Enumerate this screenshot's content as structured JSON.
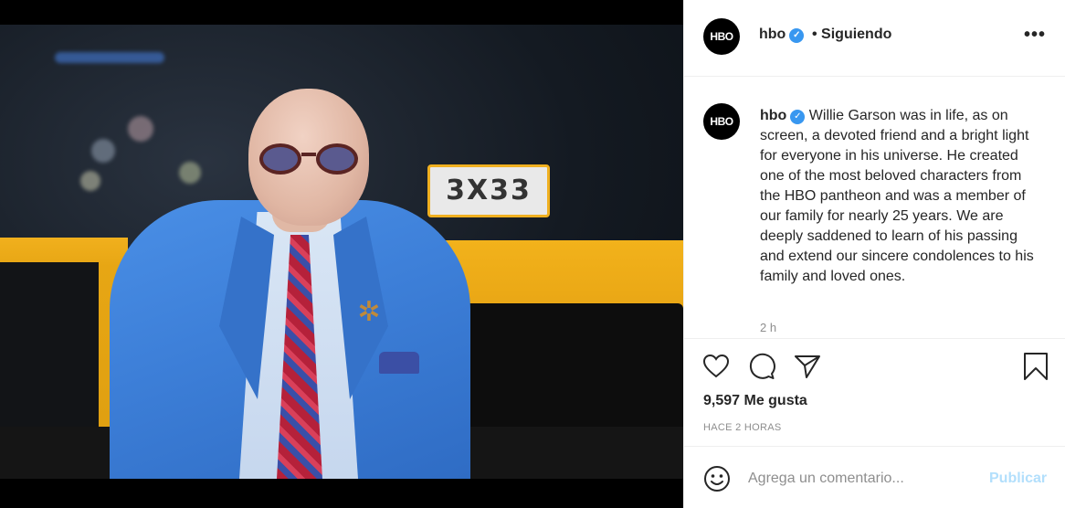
{
  "post": {
    "photo_sign_text": "3X33"
  },
  "header": {
    "avatar_text": "HBO",
    "username": "hbo",
    "verified_icon": "check-icon",
    "follow_status": "• Siguiendo",
    "more_label": "•••"
  },
  "caption": {
    "avatar_text": "HBO",
    "username": "hbo",
    "text": "Willie Garson was in life, as on screen, a devoted friend and a bright light for everyone in his universe. He created one of the most beloved characters from the HBO pantheon and was a member of our family for nearly 25 years. We are deeply saddened to learn of his passing and extend our sincere condolences to his family and loved ones.",
    "time": "2 h"
  },
  "actions": {
    "icons": [
      "heart-icon",
      "comment-icon",
      "share-icon",
      "bookmark-icon"
    ],
    "likes": "9,597 Me gusta",
    "posted_ago": "HACE 2 HORAS"
  },
  "comment": {
    "emoji_icon": "smiley-icon",
    "placeholder": "Agrega un comentario...",
    "publish_label": "Publicar"
  },
  "colors": {
    "verified": "#3897f0",
    "publish_disabled": "#b2dffc",
    "text": "#262626",
    "muted": "#8e8e8e"
  }
}
